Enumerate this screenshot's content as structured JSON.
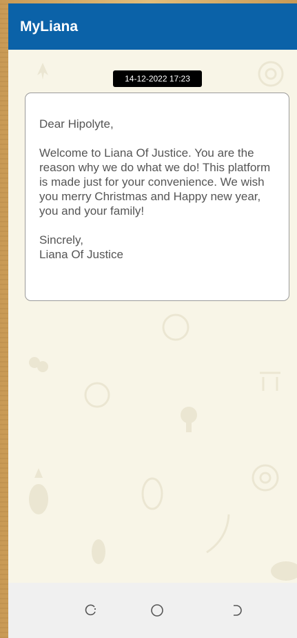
{
  "app": {
    "title": "MyLiana"
  },
  "message": {
    "timestamp": "14-12-2022 17:23",
    "greeting": "Dear Hipolyte,",
    "body": "Welcome to Liana Of Justice. You are the reason why we do what we do! This platform is made just for your convenience. We wish you merry Christmas and Happy new year, you and your family!",
    "closing_line1": "Sincrely,",
    "closing_line2": "Liana Of Justice"
  },
  "navigation": {
    "buttons": [
      "recent-apps",
      "home",
      "back"
    ]
  },
  "colors": {
    "appbar": "#0b62a8",
    "background": "#f8f5e7",
    "card": "#ffffff",
    "text": "#555555",
    "timestamp_bg": "#000000",
    "navbar": "#f0f0f0"
  }
}
